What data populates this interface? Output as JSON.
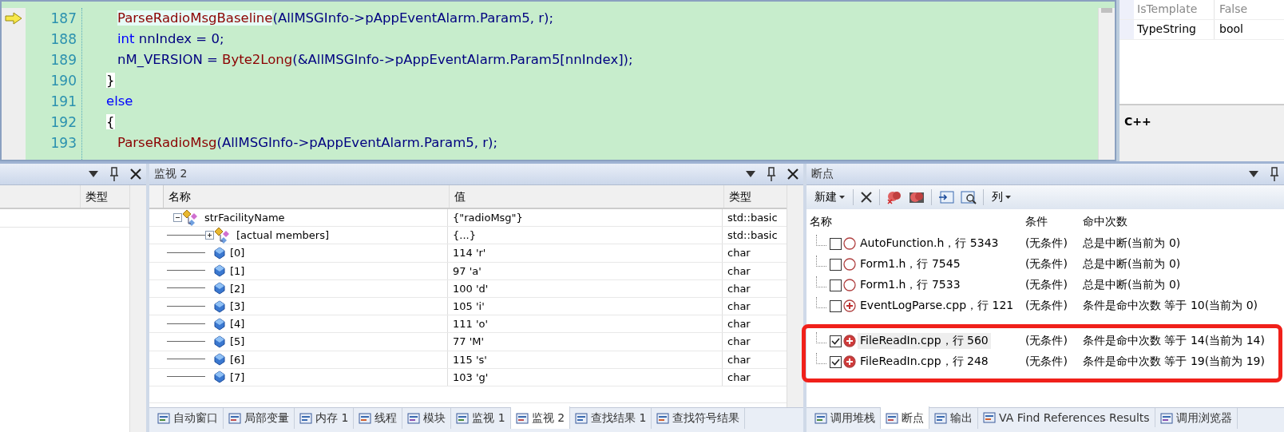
{
  "editor": {
    "lines": [
      {
        "number": "187",
        "current": true,
        "kind": "inner",
        "tokens": [
          {
            "kind": "func",
            "text": "ParseRadioMsgBaseline"
          },
          {
            "kind": "ident",
            "text": "(AllMSGInfo->pAppEventAlarm.Param5, r);"
          }
        ]
      },
      {
        "number": "188",
        "current": false,
        "kind": "inner",
        "tokens": [
          {
            "kind": "keyword",
            "text": "int"
          },
          {
            "kind": "ident",
            "text": " nnIndex = 0;"
          }
        ]
      },
      {
        "number": "189",
        "current": false,
        "kind": "inner",
        "tokens": [
          {
            "kind": "ident",
            "text": "nM_VERSION = "
          },
          {
            "kind": "func",
            "text": "Byte2Long"
          },
          {
            "kind": "ident",
            "text": "(&AllMSGInfo->pAppEventAlarm.Param5[nnIndex]);"
          }
        ]
      },
      {
        "number": "190",
        "current": false,
        "kind": "outer",
        "tokens": [
          {
            "kind": "punct",
            "text": "}"
          }
        ]
      },
      {
        "number": "191",
        "current": false,
        "kind": "outer",
        "tokens": [
          {
            "kind": "keyword",
            "text": "else"
          }
        ]
      },
      {
        "number": "192",
        "current": false,
        "kind": "outer",
        "tokens": [
          {
            "kind": "punct",
            "text": "{"
          }
        ]
      },
      {
        "number": "193",
        "current": false,
        "kind": "inner",
        "tokens": [
          {
            "kind": "func",
            "text": "ParseRadioMsg"
          },
          {
            "kind": "ident",
            "text": "(AllMSGInfo->pAppEventAlarm.Param5, r);"
          }
        ]
      }
    ]
  },
  "properties": {
    "rows": [
      {
        "name": "IsTemplate",
        "value": "False",
        "disabled": true
      },
      {
        "name": "TypeString",
        "value": "bool",
        "disabled": false
      }
    ],
    "description": "C++"
  },
  "locals_panel": {
    "columns": [
      "类型"
    ]
  },
  "watch_panel": {
    "title": "监视 2",
    "columns": [
      "名称",
      "值",
      "类型"
    ],
    "rows": [
      {
        "name": "strFacilityName",
        "value": "{\"radioMsg\"}",
        "type": "std::basic",
        "kind": "object",
        "expanded": true,
        "children": [
          {
            "name": "[actual members]",
            "value": "{...}",
            "type": "std::basic",
            "kind": "object",
            "expanded": false
          },
          {
            "name": "[0]",
            "value": "114 'r'",
            "type": "char",
            "kind": "field"
          },
          {
            "name": "[1]",
            "value": "97 'a'",
            "type": "char",
            "kind": "field"
          },
          {
            "name": "[2]",
            "value": "100 'd'",
            "type": "char",
            "kind": "field"
          },
          {
            "name": "[3]",
            "value": "105 'i'",
            "type": "char",
            "kind": "field"
          },
          {
            "name": "[4]",
            "value": "111 'o'",
            "type": "char",
            "kind": "field"
          },
          {
            "name": "[5]",
            "value": "77 'M'",
            "type": "char",
            "kind": "field"
          },
          {
            "name": "[6]",
            "value": "115 's'",
            "type": "char",
            "kind": "field"
          },
          {
            "name": "[7]",
            "value": "103 'g'",
            "type": "char",
            "kind": "field"
          }
        ]
      }
    ],
    "tabs": [
      {
        "label": "自动窗口",
        "selected": false
      },
      {
        "label": "局部变量",
        "selected": false
      },
      {
        "label": "内存 1",
        "selected": false
      },
      {
        "label": "线程",
        "selected": false
      },
      {
        "label": "模块",
        "selected": false
      },
      {
        "label": "监视 1",
        "selected": false
      },
      {
        "label": "监视 2",
        "selected": true
      },
      {
        "label": "查找结果 1",
        "selected": false
      },
      {
        "label": "查找符号结果",
        "selected": false
      }
    ]
  },
  "breakpoints_panel": {
    "title": "断点",
    "toolbar": {
      "new_label": "新建",
      "columns_label": "列"
    },
    "columns": [
      "名称",
      "条件",
      "命中次数"
    ],
    "rows": [
      {
        "name": "AutoFunction.h，行 5343",
        "condition": "(无条件)",
        "hit_count": "总是中断(当前为 0)",
        "checked": false,
        "conditional": false,
        "highlighted": false
      },
      {
        "name": "Form1.h，行 7545",
        "condition": "(无条件)",
        "hit_count": "总是中断(当前为 0)",
        "checked": false,
        "conditional": false,
        "highlighted": false
      },
      {
        "name": "Form1.h，行 7533",
        "condition": "(无条件)",
        "hit_count": "总是中断(当前为 0)",
        "checked": false,
        "conditional": false,
        "highlighted": false
      },
      {
        "name": "EventLogParse.cpp，行 121",
        "condition": "(无条件)",
        "hit_count": "条件是命中次数 等于 10(当前为 0)",
        "checked": false,
        "conditional": true,
        "highlighted": false
      },
      {
        "name": "FileReadIn.cpp，行 560",
        "condition": "(无条件)",
        "hit_count": "条件是命中次数 等于 14(当前为 14)",
        "checked": true,
        "conditional": true,
        "highlighted": true
      },
      {
        "name": "FileReadIn.cpp，行 248",
        "condition": "(无条件)",
        "hit_count": "条件是命中次数 等于 19(当前为 19)",
        "checked": true,
        "conditional": true,
        "highlighted": true
      }
    ],
    "tabs": [
      {
        "label": "调用堆栈",
        "selected": false
      },
      {
        "label": "断点",
        "selected": true
      },
      {
        "label": "输出",
        "selected": false
      },
      {
        "label": "VA Find References Results",
        "selected": false
      },
      {
        "label": "调用浏览器",
        "selected": false
      }
    ]
  }
}
